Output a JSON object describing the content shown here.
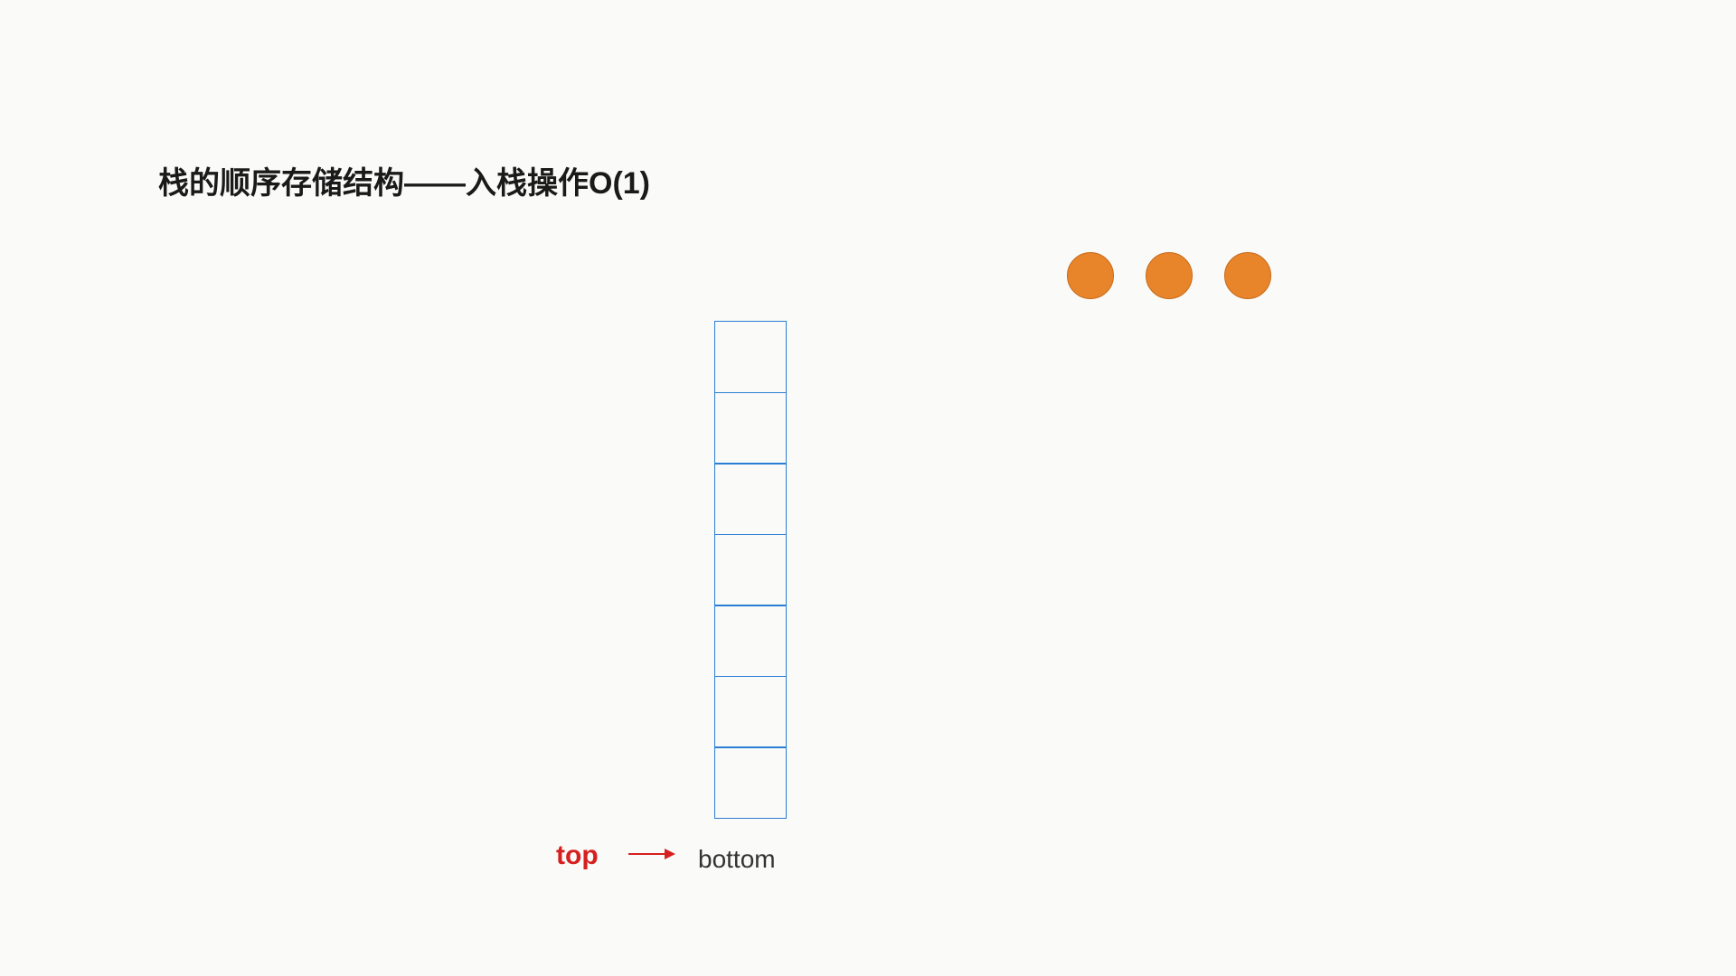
{
  "title": "栈的顺序存储结构——入栈操作O(1)",
  "labels": {
    "top": "top",
    "bottom": "bottom"
  },
  "stack": {
    "cell_count": 7,
    "cell_color": "#2a7fd4"
  },
  "elements": {
    "circle_count": 3,
    "circle_color": "#e8852b"
  },
  "colors": {
    "title_text": "#1a1a1a",
    "top_label": "#d62020",
    "arrow": "#d62020",
    "bottom_label": "#333",
    "background": "#fafaf8"
  }
}
